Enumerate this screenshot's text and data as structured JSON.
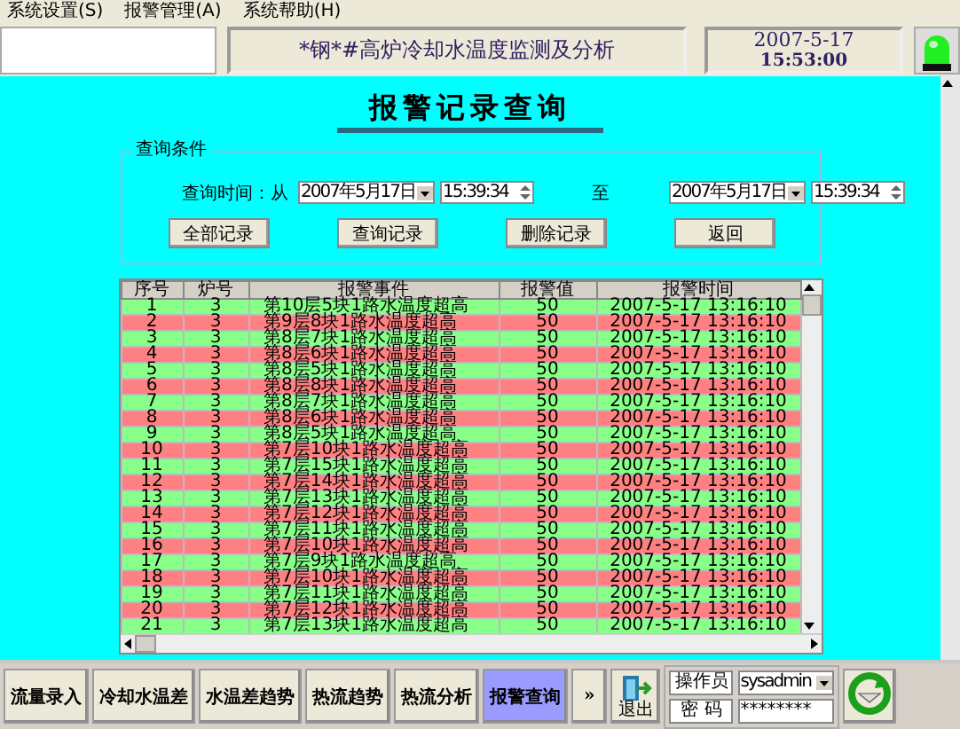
{
  "menu": [
    "系统设置(S)",
    "报警管理(A)",
    "系统帮助(H)"
  ],
  "header": {
    "title": "*钢*#高炉冷却水温度监测及分析",
    "date": "2007-5-17",
    "time": "15:53:00",
    "alarm_light": {
      "on": true
    }
  },
  "page_title": "报警记录查询",
  "query": {
    "legend": "查询条件",
    "label_from": "查询时间：从",
    "from_date": "2007年5月17日",
    "from_time": "15:39:34",
    "label_to": "至",
    "to_date": "2007年5月17日",
    "to_time": "15:39:34",
    "buttons": [
      "全部记录",
      "查询记录",
      "删除记录",
      "返回"
    ]
  },
  "table": {
    "columns": [
      "序号",
      "炉号",
      "报警事件",
      "报警值",
      "报警时间"
    ],
    "rows": [
      {
        "cells": [
          "1",
          "3",
          "第10层5块1路水温度超高",
          "50",
          "2007-5-17 13:16:10"
        ],
        "color": "#88ff88"
      },
      {
        "cells": [
          "2",
          "3",
          "第9层8块1路水温度超高",
          "50",
          "2007-5-17 13:16:10"
        ],
        "color": "#ff8080"
      },
      {
        "cells": [
          "3",
          "3",
          "第8层7块1路水温度超高",
          "50",
          "2007-5-17 13:16:10"
        ],
        "color": "#88ff88"
      },
      {
        "cells": [
          "4",
          "3",
          "第8层6块1路水温度超高",
          "50",
          "2007-5-17 13:16:10"
        ],
        "color": "#ff8080"
      },
      {
        "cells": [
          "5",
          "3",
          "第8层5块1路水温度超高",
          "50",
          "2007-5-17 13:16:10"
        ],
        "color": "#88ff88"
      },
      {
        "cells": [
          "6",
          "3",
          "第8层8块1路水温度超高",
          "50",
          "2007-5-17 13:16:10"
        ],
        "color": "#ff8080"
      },
      {
        "cells": [
          "7",
          "3",
          "第8层7块1路水温度超高",
          "50",
          "2007-5-17 13:16:10"
        ],
        "color": "#88ff88"
      },
      {
        "cells": [
          "8",
          "3",
          "第8层6块1路水温度超高",
          "50",
          "2007-5-17 13:16:10"
        ],
        "color": "#ff8080"
      },
      {
        "cells": [
          "9",
          "3",
          "第8层5块1路水温度超高",
          "50",
          "2007-5-17 13:16:10"
        ],
        "color": "#88ff88"
      },
      {
        "cells": [
          "10",
          "3",
          "第7层10块1路水温度超高",
          "50",
          "2007-5-17 13:16:10"
        ],
        "color": "#ff8080"
      },
      {
        "cells": [
          "11",
          "3",
          "第7层15块1路水温度超高",
          "50",
          "2007-5-17 13:16:10"
        ],
        "color": "#88ff88"
      },
      {
        "cells": [
          "12",
          "3",
          "第7层14块1路水温度超高",
          "50",
          "2007-5-17 13:16:10"
        ],
        "color": "#ff8080"
      },
      {
        "cells": [
          "13",
          "3",
          "第7层13块1路水温度超高",
          "50",
          "2007-5-17 13:16:10"
        ],
        "color": "#88ff88"
      },
      {
        "cells": [
          "14",
          "3",
          "第7层12块1路水温度超高",
          "50",
          "2007-5-17 13:16:10"
        ],
        "color": "#ff8080"
      },
      {
        "cells": [
          "15",
          "3",
          "第7层11块1路水温度超高",
          "50",
          "2007-5-17 13:16:10"
        ],
        "color": "#88ff88"
      },
      {
        "cells": [
          "16",
          "3",
          "第7层10块1路水温度超高",
          "50",
          "2007-5-17 13:16:10"
        ],
        "color": "#ff8080"
      },
      {
        "cells": [
          "17",
          "3",
          "第7层9块1路水温度超高",
          "50",
          "2007-5-17 13:16:10"
        ],
        "color": "#88ff88"
      },
      {
        "cells": [
          "18",
          "3",
          "第7层10块1路水温度超高",
          "50",
          "2007-5-17 13:16:10"
        ],
        "color": "#ff8080"
      },
      {
        "cells": [
          "19",
          "3",
          "第7层11块1路水温度超高",
          "50",
          "2007-5-17 13:16:10"
        ],
        "color": "#88ff88"
      },
      {
        "cells": [
          "20",
          "3",
          "第7层12块1路水温度超高",
          "50",
          "2007-5-17 13:16:10"
        ],
        "color": "#ff8080"
      },
      {
        "cells": [
          "21",
          "3",
          "第7层13块1路水温度超高",
          "50",
          "2007-5-17 13:16:10"
        ],
        "color": "#88ff88"
      }
    ]
  },
  "toolbar": {
    "buttons": [
      {
        "label": "流量录入",
        "selected": false
      },
      {
        "label": "冷却水温差",
        "selected": false
      },
      {
        "label": "水温差趋势",
        "selected": false
      },
      {
        "label": "热流趋势",
        "selected": false
      },
      {
        "label": "热流分析",
        "selected": false
      },
      {
        "label": "报警查询",
        "selected": true
      }
    ],
    "more": "»",
    "exit": "退出",
    "operator_label": "操作员",
    "operator": "sysadmin",
    "password_label": "密 码",
    "password": "********"
  }
}
